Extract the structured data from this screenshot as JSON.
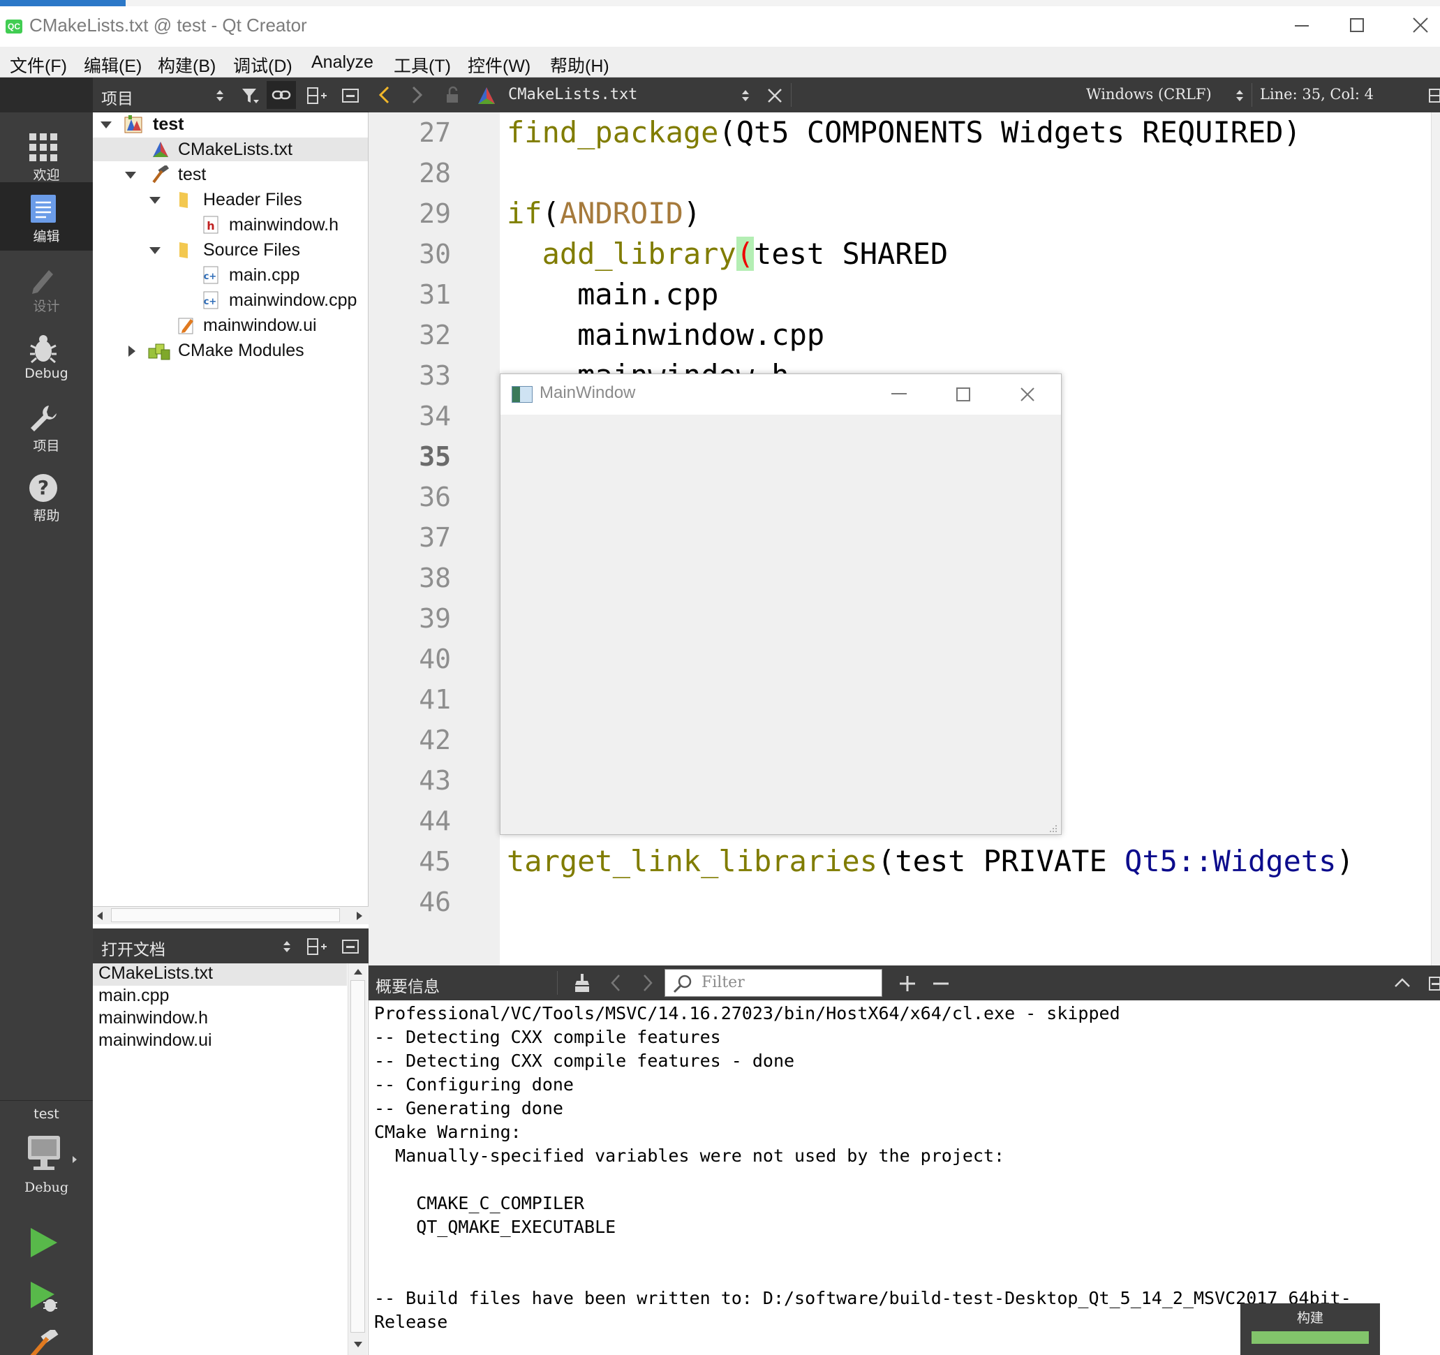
{
  "window": {
    "title": "CMakeLists.txt @ test - Qt Creator",
    "logo_text": "QC"
  },
  "menu": [
    "文件(F)",
    "编辑(E)",
    "构建(B)",
    "调试(D)",
    "Analyze",
    "工具(T)",
    "控件(W)",
    "帮助(H)"
  ],
  "modes": [
    {
      "label": "欢迎",
      "icon": "grid-icon"
    },
    {
      "label": "编辑",
      "icon": "document-edit-icon"
    },
    {
      "label": "设计",
      "icon": "pencil-icon"
    },
    {
      "label": "Debug",
      "icon": "bug-icon"
    },
    {
      "label": "项目",
      "icon": "wrench-icon"
    },
    {
      "label": "帮助",
      "icon": "help-icon"
    }
  ],
  "kit": {
    "project": "test",
    "config": "Debug"
  },
  "project_panel": {
    "title": "项目"
  },
  "tree": [
    {
      "label": "test",
      "bold": true
    },
    {
      "label": "CMakeLists.txt",
      "selected": true
    },
    {
      "label": "test"
    },
    {
      "label": "Header Files"
    },
    {
      "label": "mainwindow.h"
    },
    {
      "label": "Source Files"
    },
    {
      "label": "main.cpp"
    },
    {
      "label": "mainwindow.cpp"
    },
    {
      "label": "mainwindow.ui"
    },
    {
      "label": "CMake Modules"
    }
  ],
  "open_docs": {
    "title": "打开文档",
    "items": [
      "CMakeLists.txt",
      "main.cpp",
      "mainwindow.h",
      "mainwindow.ui"
    ]
  },
  "editor": {
    "filename": "CMakeLists.txt",
    "encoding": "Windows (CRLF)",
    "position": "Line: 35, Col: 4",
    "line_numbers": [
      "27",
      "28",
      "29",
      "30",
      "31",
      "32",
      "33",
      "34",
      "35",
      "36",
      "37",
      "38",
      "39",
      "40",
      "41",
      "42",
      "43",
      "44",
      "45",
      "46"
    ],
    "current_line": "35",
    "code": {
      "l27_fn": "find_package",
      "l27_rest": "(Qt5 COMPONENTS Widgets REQUIRED)",
      "l29_kw": "if",
      "l29_open": "(",
      "l29_var": "ANDROID",
      "l29_close": ")",
      "l30_fn": "  add_library",
      "l30_paren": "(",
      "l30_rest": "test SHARED",
      "l31": "    main.cpp",
      "l32": "    mainwindow.cpp",
      "l33": "    mainwindow.h",
      "l45_fn": "target_link_libraries",
      "l45_mid": "(test PRIVATE ",
      "l45_ns": "Qt5::Widgets",
      "l45_end": ")"
    }
  },
  "app_window": {
    "title": "MainWindow"
  },
  "output": {
    "title": "概要信息",
    "filter_placeholder": "Filter",
    "lines": [
      "Professional/VC/Tools/MSVC/14.16.27023/bin/HostX64/x64/cl.exe - skipped",
      "-- Detecting CXX compile features",
      "-- Detecting CXX compile features - done",
      "-- Configuring done",
      "-- Generating done",
      "CMake Warning:",
      "  Manually-specified variables were not used by the project:",
      "",
      "    CMAKE_C_COMPILER",
      "    QT_QMAKE_EXECUTABLE",
      "",
      "",
      "-- Build files have been written to: D:/software/build-test-Desktop_Qt_5_14_2_MSVC2017_64bit-",
      "Release"
    ]
  },
  "build_progress": {
    "label": "构建",
    "fraction": 1.0
  }
}
